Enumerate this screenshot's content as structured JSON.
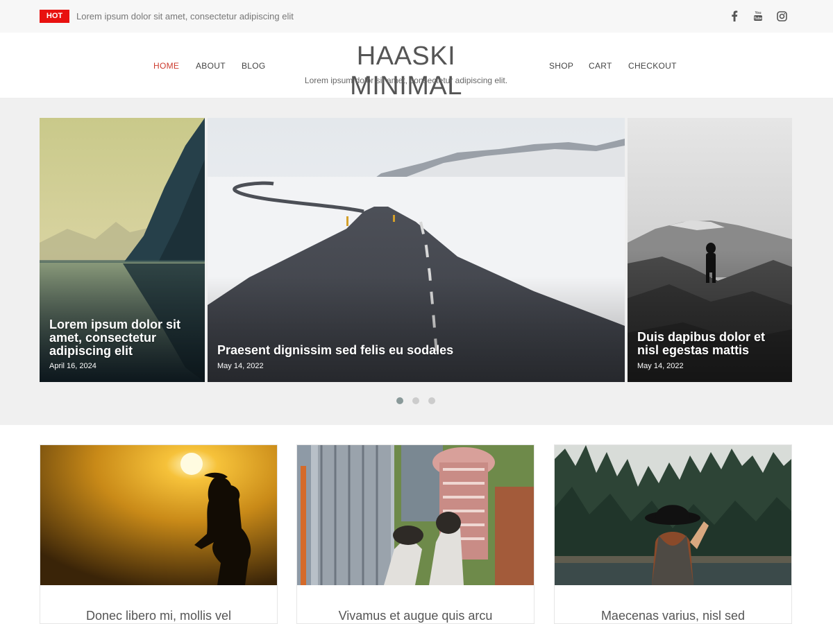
{
  "topbar": {
    "badge": "HOT",
    "ticker": "Lorem ipsum dolor sit amet, consectetur adipiscing elit",
    "social": [
      "facebook-icon",
      "youtube-icon",
      "instagram-icon"
    ]
  },
  "header": {
    "site_title": "HAASKI MINIMAL",
    "tagline": "Lorem ipsum dolor sit amet, consectetur adipiscing elit.",
    "nav_left": [
      "HOME",
      "ABOUT",
      "BLOG"
    ],
    "nav_right": [
      "SHOP",
      "CART",
      "CHECKOUT"
    ],
    "active_color": "#cc3a2d"
  },
  "slider": {
    "slides": [
      {
        "title": "Lorem ipsum dolor sit amet, consectetur adipiscing elit",
        "date": "April 16, 2024"
      },
      {
        "title": "Praesent dignissim sed felis eu sodales",
        "date": "May 14, 2022"
      },
      {
        "title": "Duis dapibus dolor et nisl egestas mattis",
        "date": "May 14, 2022"
      }
    ],
    "dots": 3,
    "active_dot": 0
  },
  "posts": [
    {
      "title": "Donec libero mi, mollis vel"
    },
    {
      "title": "Vivamus et augue quis arcu"
    },
    {
      "title": "Maecenas varius, nisl sed"
    }
  ],
  "colors": {
    "hot": "#e8110f",
    "accent": "#cc3a2d"
  }
}
